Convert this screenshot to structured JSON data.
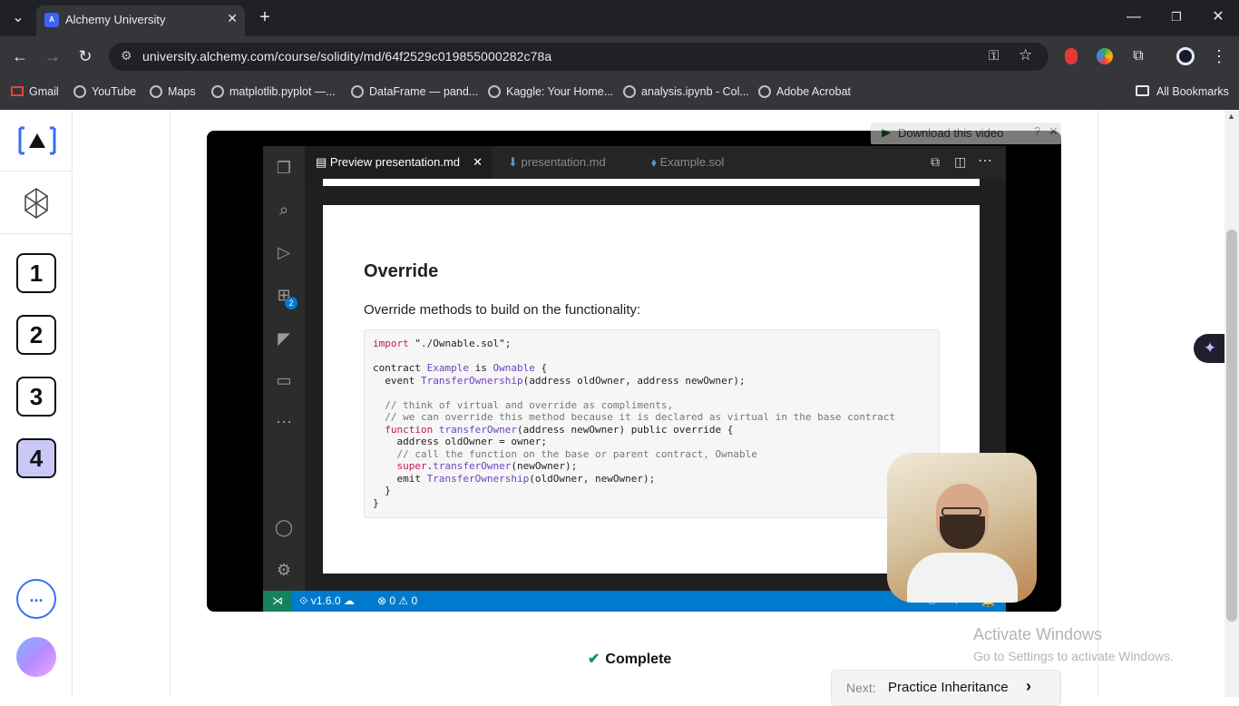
{
  "browser": {
    "tab_title": "Alchemy University",
    "tab_favicon": "A",
    "url": "university.alchemy.com/course/solidity/md/64f2529c019855000282c78a",
    "new_tab_symbol": "+",
    "bookmarks": [
      {
        "label": "Gmail"
      },
      {
        "label": "YouTube"
      },
      {
        "label": "Maps"
      },
      {
        "label": "matplotlib.pyplot —..."
      },
      {
        "label": "DataFrame — pand..."
      },
      {
        "label": "Kaggle: Your Home..."
      },
      {
        "label": "analysis.ipynb - Col..."
      },
      {
        "label": "Adobe Acrobat"
      }
    ],
    "all_bookmarks": "All Bookmarks"
  },
  "sidebar": {
    "levels": [
      "1",
      "2",
      "3",
      "4"
    ],
    "active_level": "4",
    "more_label": "..."
  },
  "video": {
    "download_label": "Download this video",
    "editor": {
      "tabs": [
        "Preview presentation.md",
        "presentation.md",
        "Example.sol"
      ],
      "active_tab": "Preview presentation.md",
      "extensions_badge": "2",
      "status_version": "v1.6.0",
      "status_errors": "0",
      "status_warnings": "0"
    },
    "slide": {
      "title": "Override",
      "subtitle": "Override methods to build on the functionality:",
      "code_lines": [
        "import \"./Ownable.sol\";",
        "",
        "contract Example is Ownable {",
        "  event TransferOwnership(address oldOwner, address newOwner);",
        "",
        "  // think of virtual and override as compliments,",
        "  // we can override this method because it is declared as virtual in the base contract",
        "  function transferOwner(address newOwner) public override {",
        "    address oldOwner = owner;",
        "    // call the function on the base or parent contract, Ownable",
        "    super.transferOwner(newOwner);",
        "    emit TransferOwnership(oldOwner, newOwner);",
        "  }",
        "}"
      ]
    }
  },
  "footer": {
    "complete_label": "Complete",
    "next_prefix": "Next:",
    "next_label": "Practice Inheritance"
  },
  "watermark": {
    "line1": "Activate Windows",
    "line2": "Go to Settings to activate Windows."
  },
  "colors": {
    "accent": "#c9c8f7",
    "complete": "#1a8f67",
    "vscode_status": "#007acc"
  }
}
